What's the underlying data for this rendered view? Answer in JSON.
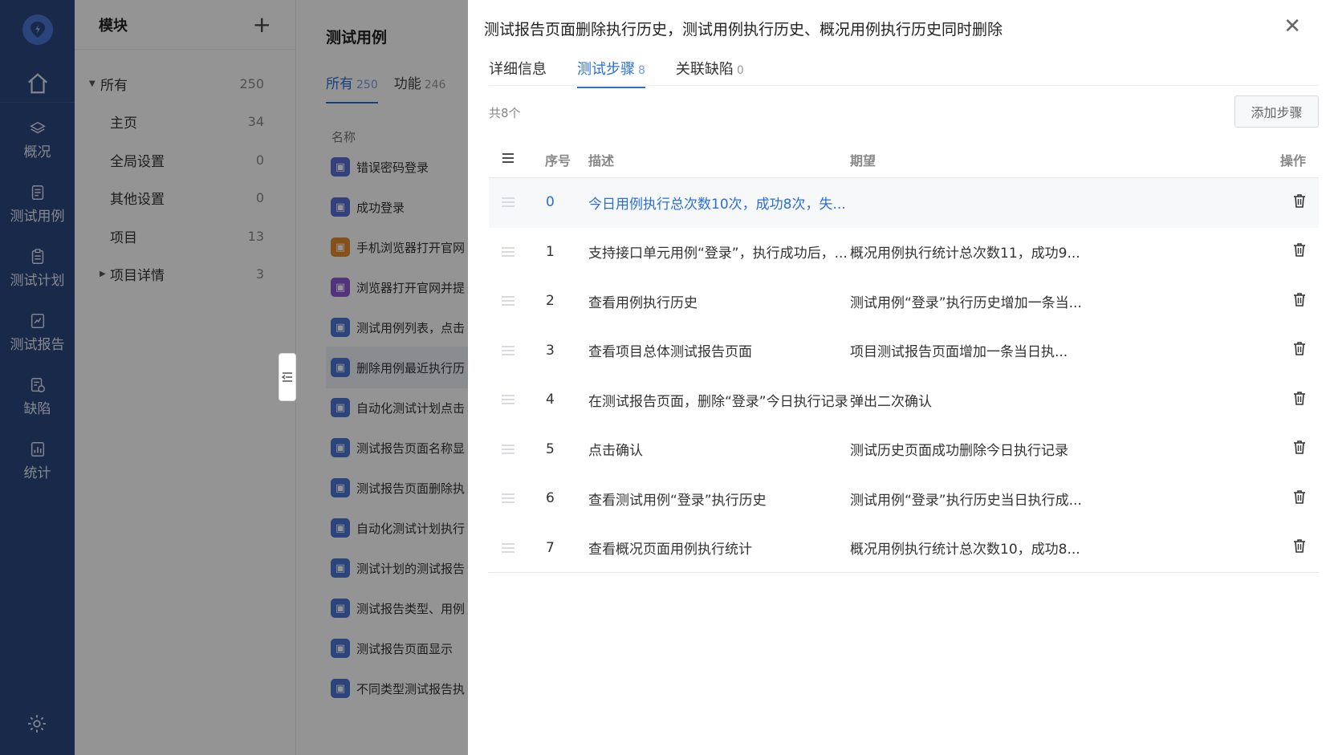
{
  "nav": {
    "items": [
      {
        "label": "概况",
        "icon": "layers-icon"
      },
      {
        "label": "测试用例",
        "icon": "document-icon"
      },
      {
        "label": "测试计划",
        "icon": "clipboard-icon"
      },
      {
        "label": "测试报告",
        "icon": "report-icon"
      },
      {
        "label": "缺陷",
        "icon": "bug-doc-icon"
      },
      {
        "label": "统计",
        "icon": "chart-icon"
      }
    ]
  },
  "modules": {
    "title": "模块",
    "items": [
      {
        "name": "所有",
        "count": "250"
      },
      {
        "name": "主页",
        "count": "34"
      },
      {
        "name": "全局设置",
        "count": "0"
      },
      {
        "name": "其他设置",
        "count": "0"
      },
      {
        "name": "项目",
        "count": "13"
      },
      {
        "name": "项目详情",
        "count": "3"
      }
    ]
  },
  "cases": {
    "title": "测试用例",
    "tabs": [
      {
        "label": "所有",
        "count": "250"
      },
      {
        "label": "功能",
        "count": "246"
      }
    ],
    "column_name": "名称",
    "rows": [
      {
        "name": "错误密码登录",
        "color": "#5b6fd6"
      },
      {
        "name": "成功登录",
        "color": "#5b6fd6"
      },
      {
        "name": "手机浏览器打开官网",
        "color": "#e58a2c"
      },
      {
        "name": "浏览器打开官网并提",
        "color": "#8e5bd6"
      },
      {
        "name": "测试用例列表，点击",
        "color": "#4a76d6"
      },
      {
        "name": "删除用例最近执行历",
        "color": "#4a76d6"
      },
      {
        "name": "自动化测试计划点击",
        "color": "#4a76d6"
      },
      {
        "name": "测试报告页面名称显",
        "color": "#4a76d6"
      },
      {
        "name": "测试报告页面删除执",
        "color": "#4a76d6"
      },
      {
        "name": "自动化测试计划执行",
        "color": "#4a76d6"
      },
      {
        "name": "测试计划的测试报告",
        "color": "#4a76d6"
      },
      {
        "name": "测试报告类型、用例",
        "color": "#4a76d6"
      },
      {
        "name": "测试报告页面显示",
        "color": "#4a76d6"
      },
      {
        "name": "不同类型测试报告执",
        "color": "#4a76d6"
      }
    ]
  },
  "drawer": {
    "title": "测试报告页面删除执行历史，测试用例执行历史、概况用例执行历史同时删除",
    "tabs": [
      {
        "label": "详细信息",
        "count": ""
      },
      {
        "label": "测试步骤",
        "count": "8"
      },
      {
        "label": "关联缺陷",
        "count": "0"
      }
    ],
    "count_text": "共8个",
    "add_label": "添加步骤",
    "columns": {
      "seq": "序号",
      "desc": "描述",
      "expect": "期望",
      "op": "操作"
    },
    "steps": [
      {
        "seq": "0",
        "desc": "今日用例执行总次数10次，成功8次，失...",
        "expect": ""
      },
      {
        "seq": "1",
        "desc": "支持接口单元用例“登录”，执行成功后，...",
        "expect": "概况用例执行统计总次数11，成功9..."
      },
      {
        "seq": "2",
        "desc": "查看用例执行历史",
        "expect": "测试用例“登录”执行历史增加一条当..."
      },
      {
        "seq": "3",
        "desc": "查看项目总体测试报告页面",
        "expect": "项目测试报告页面增加一条当日执..."
      },
      {
        "seq": "4",
        "desc": "在测试报告页面，删除“登录”今日执行记录",
        "expect": "弹出二次确认"
      },
      {
        "seq": "5",
        "desc": "点击确认",
        "expect": "测试历史页面成功删除今日执行记录"
      },
      {
        "seq": "6",
        "desc": "查看测试用例“登录”执行历史",
        "expect": "测试用例“登录”执行历史当日执行成..."
      },
      {
        "seq": "7",
        "desc": "查看概况页面用例执行统计",
        "expect": "概况用例执行统计总次数10，成功8..."
      }
    ]
  }
}
